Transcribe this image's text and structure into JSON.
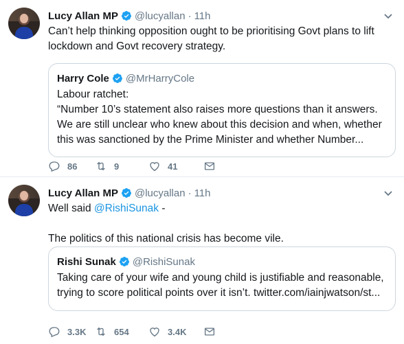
{
  "tweets": [
    {
      "author": "Lucy Allan MP",
      "handle": "@lucyallan",
      "time": "11h",
      "text": "Can’t help thinking opposition ought to be prioritising Govt plans to lift lockdown and Govt recovery strategy.",
      "quote": {
        "author": "Harry Cole",
        "handle": "@MrHarryCole",
        "line1": "Labour ratchet:",
        "line2": "“Number 10’s statement also raises more questions than it answers. We are still unclear who knew about this decision and when, whether this was sanctioned by the Prime Minister and whether Number..."
      },
      "stats": {
        "replies": "86",
        "retweets": "9",
        "likes": "41"
      }
    },
    {
      "author": "Lucy Allan MP",
      "handle": "@lucyallan",
      "time": "11h",
      "text_pre": "Well said ",
      "mention": "@RishiSunak",
      "text_post": " -",
      "text2": "The politics of this national crisis has become vile.",
      "quote": {
        "author": "Rishi Sunak",
        "handle": "@RishiSunak",
        "line1": "Taking care of your wife and young child is justifiable and reasonable, trying to score political points over it isn’t. twitter.com/iainjwatson/st..."
      },
      "stats": {
        "replies": "3.3K",
        "retweets": "654",
        "likes": "3.4K"
      }
    }
  ],
  "ui": {
    "separator_dot": "·",
    "verified_color": "#1da1f2",
    "link_color": "#1b95e0",
    "icons": [
      "verified-badge-icon",
      "chevron-down-icon",
      "reply-icon",
      "retweet-icon",
      "like-icon",
      "dm-icon"
    ]
  }
}
